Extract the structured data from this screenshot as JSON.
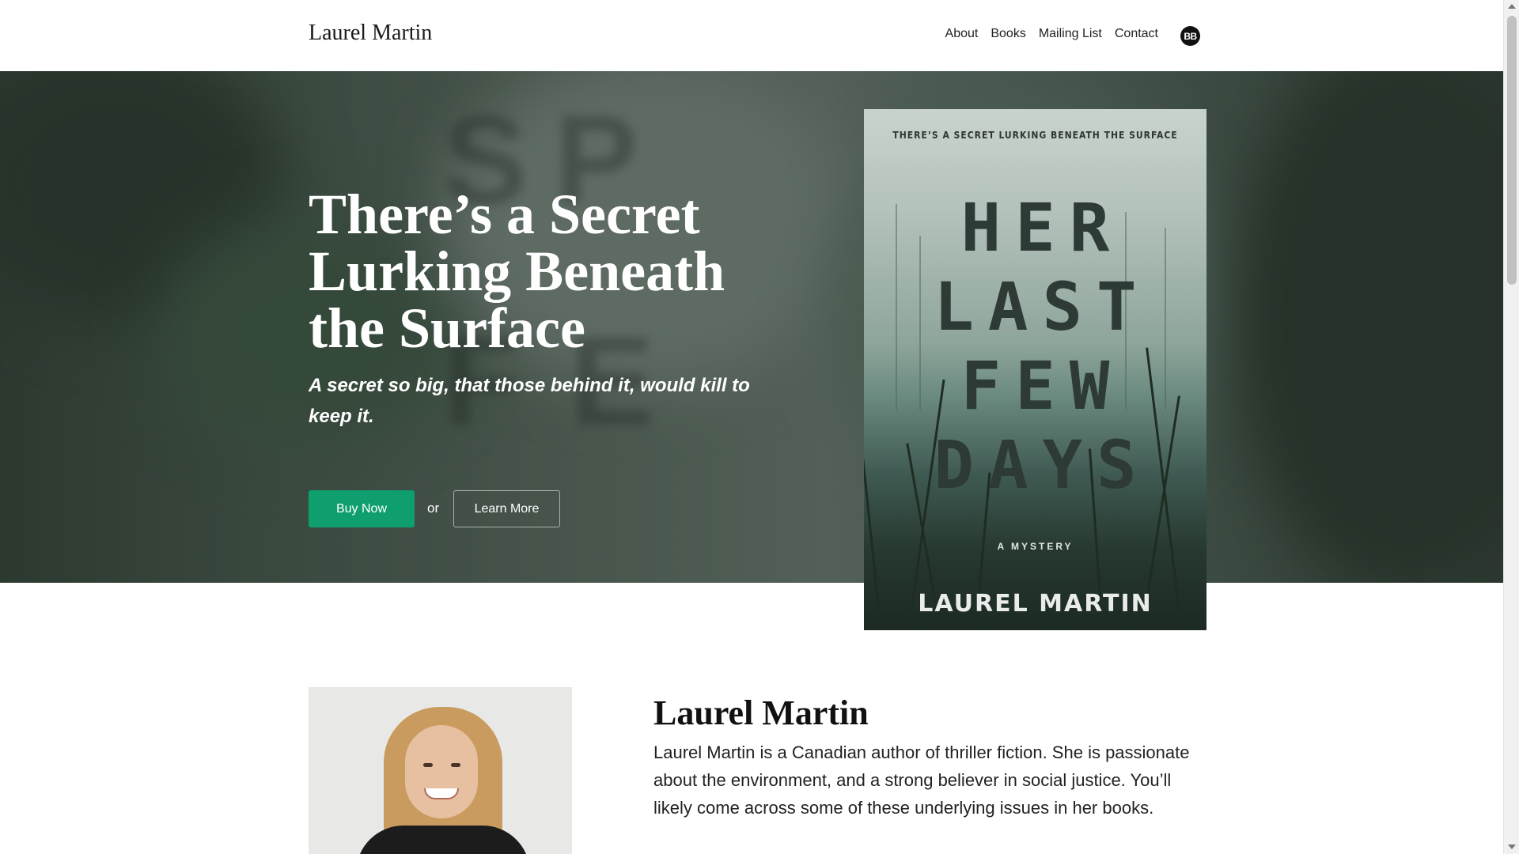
{
  "header": {
    "brand": "Laurel Martin",
    "nav": [
      "About",
      "Books",
      "Mailing List",
      "Contact"
    ],
    "profile_initials": "BB"
  },
  "hero": {
    "title": "There’s a Secret Lurking Beneath the Surface",
    "subtitle": "A secret so big, that those behind it, would kill to keep it.",
    "buy_label": "Buy Now",
    "or_text": "or",
    "learn_label": "Learn More",
    "accent_color": "#0f9e6e"
  },
  "cover": {
    "tagline": "THERE’S A SECRET LURKING BENEATH THE SURFACE",
    "title_lines": [
      "HER",
      "LAST",
      "FEW",
      "DAYS"
    ],
    "genre": "A MYSTERY",
    "author": "LAUREL MARTIN"
  },
  "about": {
    "name": "Laurel Martin",
    "bio": "Laurel Martin is a Canadian author of thriller fiction. She is passionate about the environment, and a strong believer in social justice. You’ll likely come across some of these underlying issues in her books."
  }
}
